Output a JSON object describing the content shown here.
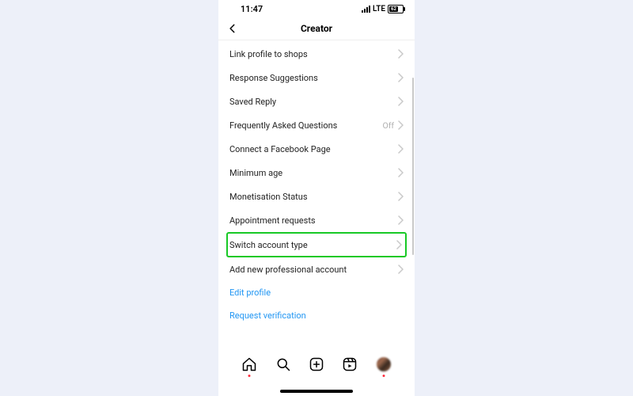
{
  "statusbar": {
    "time": "11:47",
    "network": "LTE",
    "battery": "62"
  },
  "header": {
    "title": "Creator"
  },
  "rows": {
    "link_shops": "Link profile to shops",
    "response_sugg": "Response Suggestions",
    "saved_reply": "Saved Reply",
    "faq": "Frequently Asked Questions",
    "faq_status": "Off",
    "connect_fb": "Connect a Facebook Page",
    "min_age": "Minimum age",
    "monetisation": "Monetisation Status",
    "appt": "Appointment requests",
    "switch_account": "Switch account type",
    "add_pro": "Add new professional account"
  },
  "links": {
    "edit_profile": "Edit profile",
    "request_verif": "Request verification"
  }
}
